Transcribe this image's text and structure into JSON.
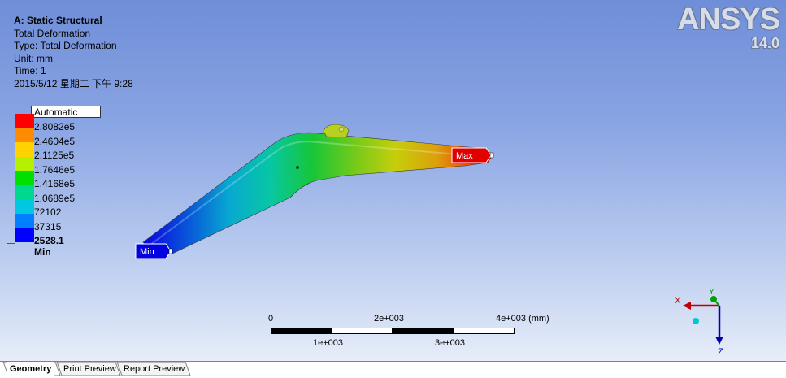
{
  "info": {
    "title": "A: Static Structural",
    "line1": "Total Deformation",
    "line2": "Type: Total Deformation",
    "line3": "Unit: mm",
    "line4": "Time: 1",
    "line5": "2015/5/12 星期二 下午 9:28"
  },
  "logo": {
    "brand": "ANSYS",
    "version": "14.0"
  },
  "legend": {
    "header": "Automatic",
    "levels": [
      "2.8082e5",
      "2.4604e5",
      "2.1125e5",
      "1.7646e5",
      "1.4168e5",
      "1.0689e5",
      "72102",
      "37315",
      "2528.1 Min"
    ],
    "colors": [
      "#ff0000",
      "#ff8c00",
      "#ffd200",
      "#b4f000",
      "#00e000",
      "#00d890",
      "#00c8e0",
      "#0080ff",
      "#0000ff"
    ]
  },
  "probes": {
    "max": "Max",
    "min": "Min"
  },
  "scale": {
    "top_labels": [
      "0",
      "2e+003",
      "4e+003 (mm)"
    ],
    "bottom_labels": [
      "1e+003",
      "3e+003"
    ]
  },
  "triad": {
    "x": "X",
    "y": "Y",
    "z": "Z"
  },
  "tabs": [
    "Geometry",
    "Print Preview",
    "Report Preview"
  ]
}
